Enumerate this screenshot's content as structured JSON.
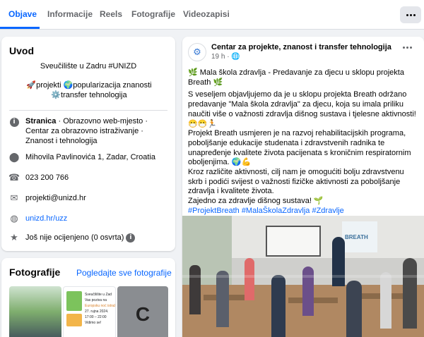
{
  "tabs": [
    "Objave",
    "Informacije",
    "Reels",
    "Fotografije",
    "Videozapisi"
  ],
  "intro": {
    "title": "Uvod",
    "bio_line1": "Sveučilište u Zadru #UNIZD",
    "bio_line2": "🚀projekti 🌍popularizacija znanosti ⚙️transfer tehnologija",
    "page_label": "Stranica",
    "page_category": " · Obrazovno web-mjesto · Centar za obrazovno istraživanje · Znanost i tehnologija",
    "address": "Mihovila Pavlinovića 1, Zadar, Croatia",
    "phone": "023 200 766",
    "email": "projekti@unizd.hr",
    "website": "unizd.hr/uzz",
    "rating": "Još nije ocijenjeno (0 osvrta)"
  },
  "photos": {
    "title": "Fotografije",
    "see_all": "Pogledajte sve fotografije",
    "thumb2_lines": [
      "Sveučilište u Zad",
      "Vas poziva na",
      "Europsku noć istraž",
      "27. rujna 2024.",
      "17:00 – 22:00",
      "Vidimo se!"
    ],
    "thumb3_letter": "C"
  },
  "post": {
    "author": "Centar za projekte, znanost i transfer tehnologija",
    "time": "19 h · 🌐",
    "title_line": "🌿 Mala škola zdravlja - Predavanje za djecu u sklopu projekta Breath 🌿",
    "paragraph1": "S veseljem objavljujemo da je u sklopu projekta Breath održano predavanje \"Mala škola zdravlja\" za djecu, koja su imala priliku naučiti više o važnosti zdravlja dišnog sustava i tjelesne aktivnosti! 😷😷🏃",
    "paragraph2": "Projekt Breath usmjeren je na razvoj rehabilitacijskih programa, poboljšanje edukacije studenata i zdravstvenih radnika te unapređenje kvalitete života pacijenata s kroničnim respiratornim oboljenjima. 🌍💪",
    "paragraph3": "Kroz različite aktivnosti, cilj nam je omogućiti bolju zdravstvenu skrb i podići svijest o važnosti fizičke aktivnosti za poboljšanje zdravlja i kvalitete života.",
    "closing": "Zajedno za zdravlje dišnog sustava! 🌱",
    "hashtags": "#ProjektBreath #MalaŠkolaZdravlja #Zdravlje #KroničneRespiratorneBolesti #Djeca #Edukacija #Rehabilitacija #TjelesnaAktivnost",
    "photo_banner": "BREATH"
  },
  "colors": {
    "accent": "#0866ff",
    "secondary_text": "#65676b",
    "background": "#f0f2f5"
  },
  "icons": [
    "more-icon",
    "info-icon",
    "location-pin-icon",
    "phone-icon",
    "email-icon",
    "globe-icon",
    "star-icon",
    "gear-logo-icon"
  ]
}
